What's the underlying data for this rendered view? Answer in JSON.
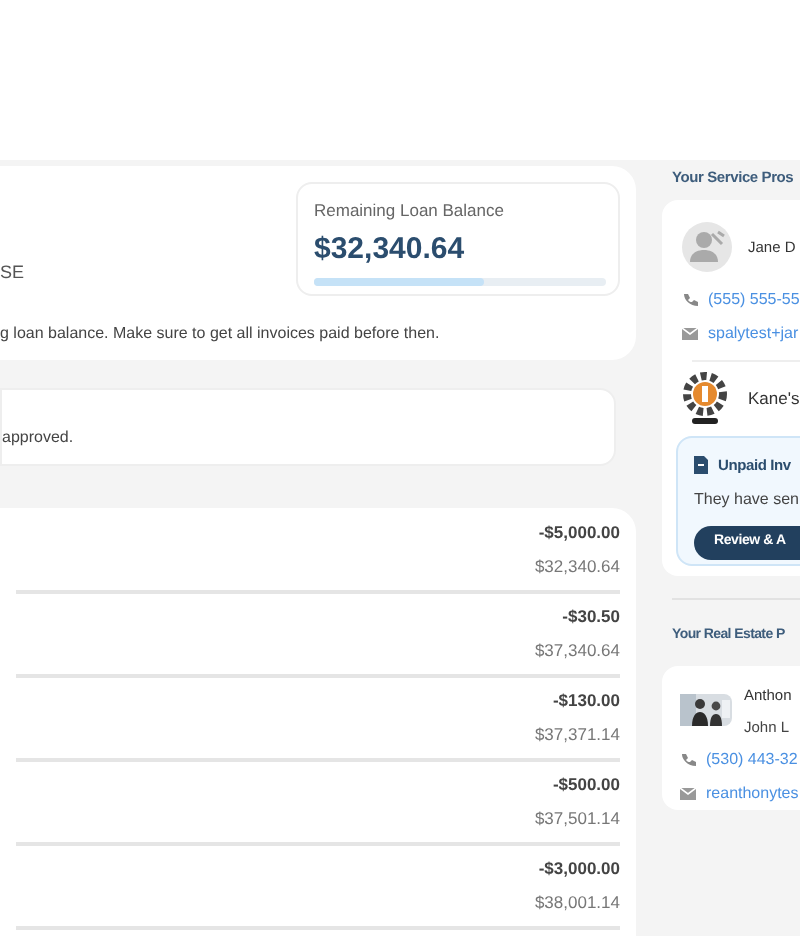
{
  "loan_card": {
    "address_fragment": "SE",
    "balance_label": "Remaining Loan Balance",
    "balance": "$32,340.64",
    "level": 0.58,
    "note": "g loan balance. Make sure to get all invoices paid before then."
  },
  "notice": {
    "text": "approved."
  },
  "transactions": [
    {
      "amount": "-$5,000.00",
      "balance": "$32,340.64"
    },
    {
      "amount": "-$30.50",
      "balance": "$37,340.64"
    },
    {
      "amount": "-$130.00",
      "balance": "$37,371.14"
    },
    {
      "amount": "-$500.00",
      "balance": "$37,501.14"
    },
    {
      "amount": "-$3,000.00",
      "balance": "$38,001.14"
    }
  ],
  "service_pros": {
    "heading": "Your Service Pros",
    "name": "Jane D",
    "phone": "(555) 555-55",
    "email": "spalytest+jar",
    "company": "Kane's",
    "unpaid": {
      "title": "Unpaid Inv",
      "text": "They have sen",
      "button": "Review & A"
    }
  },
  "real_estate": {
    "heading": "Your Real Estate P",
    "name": "Anthon",
    "company": "John L",
    "phone": "(530) 443-32",
    "email": "reanthonytes"
  }
}
